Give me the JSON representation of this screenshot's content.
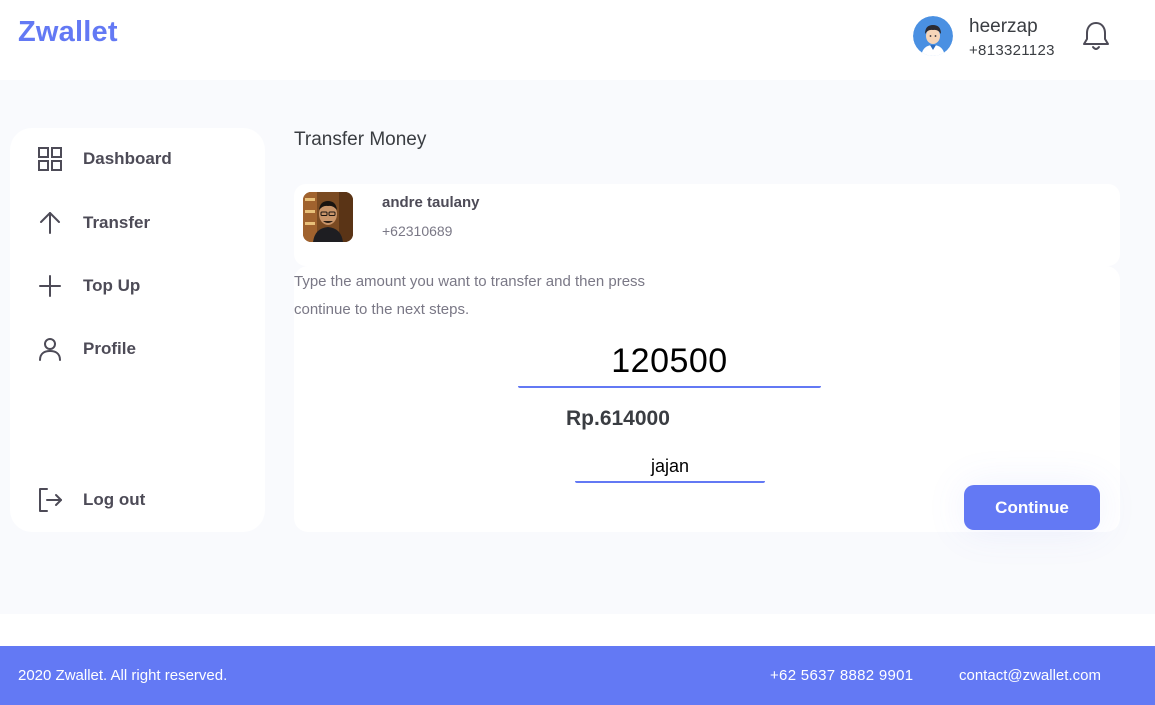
{
  "header": {
    "brand": "Zwallet",
    "user_name": "heerzap",
    "user_phone": "+813321123",
    "avatar_icon": "user-avatar",
    "notification_icon": "bell-icon"
  },
  "sidebar": {
    "items": [
      {
        "label": "Dashboard",
        "icon": "grid-icon"
      },
      {
        "label": "Transfer",
        "icon": "arrow-up-icon"
      },
      {
        "label": "Top Up",
        "icon": "plus-icon"
      },
      {
        "label": "Profile",
        "icon": "user-icon"
      }
    ],
    "logout": {
      "label": "Log out",
      "icon": "logout-icon"
    }
  },
  "main": {
    "title": "Transfer Money",
    "recipient": {
      "name": "andre taulany",
      "phone": "+62310689"
    },
    "instructions": "Type the amount you want to transfer and then press continue to the next steps.",
    "amount_value": "120500",
    "balance": "Rp.614000",
    "note_value": "jajan",
    "continue_label": "Continue"
  },
  "footer": {
    "copyright": "2020 Zwallet. All right reserved.",
    "phone": "+62 5637 8882 9901",
    "email": "contact@zwallet.com"
  },
  "colors": {
    "accent": "#6379f4",
    "background": "#f9fafd",
    "text": "#3a3d42"
  }
}
